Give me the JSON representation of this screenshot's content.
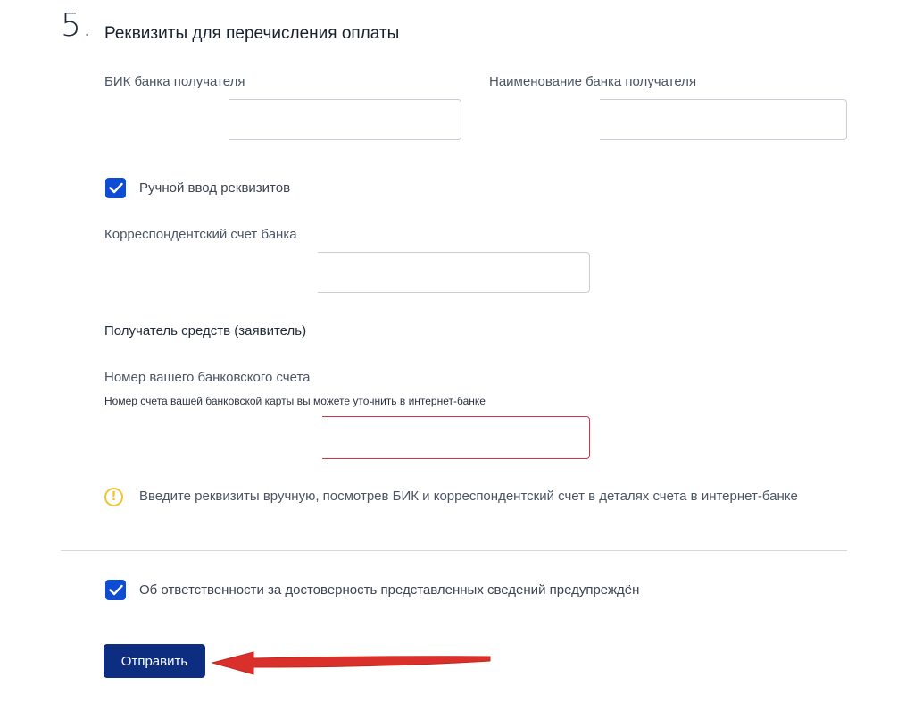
{
  "section": {
    "number": "5.",
    "title": "Реквизиты для перечисления оплаты"
  },
  "bank_bik": {
    "label": "БИК банка получателя",
    "value": ""
  },
  "bank_name": {
    "label": "Наименование банка получателя",
    "value": ""
  },
  "manual_entry": {
    "label": "Ручной ввод реквизитов",
    "checked": true
  },
  "corr_account": {
    "label": "Корреспондентский счет банка",
    "value": ""
  },
  "recipient": {
    "label": "Получатель средств (заявитель)",
    "value": ""
  },
  "account_number": {
    "label": "Номер вашего банковского счета",
    "hint": "Номер счета вашей банковской карты вы можете уточнить в интернет-банке",
    "value": ""
  },
  "warning": {
    "icon": "warning-icon",
    "text": "Введите реквизиты вручную, посмотрев БИК и корреспондентский счет в деталях счета в интернет-банке"
  },
  "responsibility": {
    "label": "Об ответственности за достоверность представленных сведений предупреждён",
    "checked": true
  },
  "submit": {
    "label": "Отправить"
  },
  "colors": {
    "primary": "#0d4cd3",
    "button": "#0d2e80",
    "error": "#d0364a",
    "warning": "#f2c230",
    "arrow": "#d9302b"
  }
}
